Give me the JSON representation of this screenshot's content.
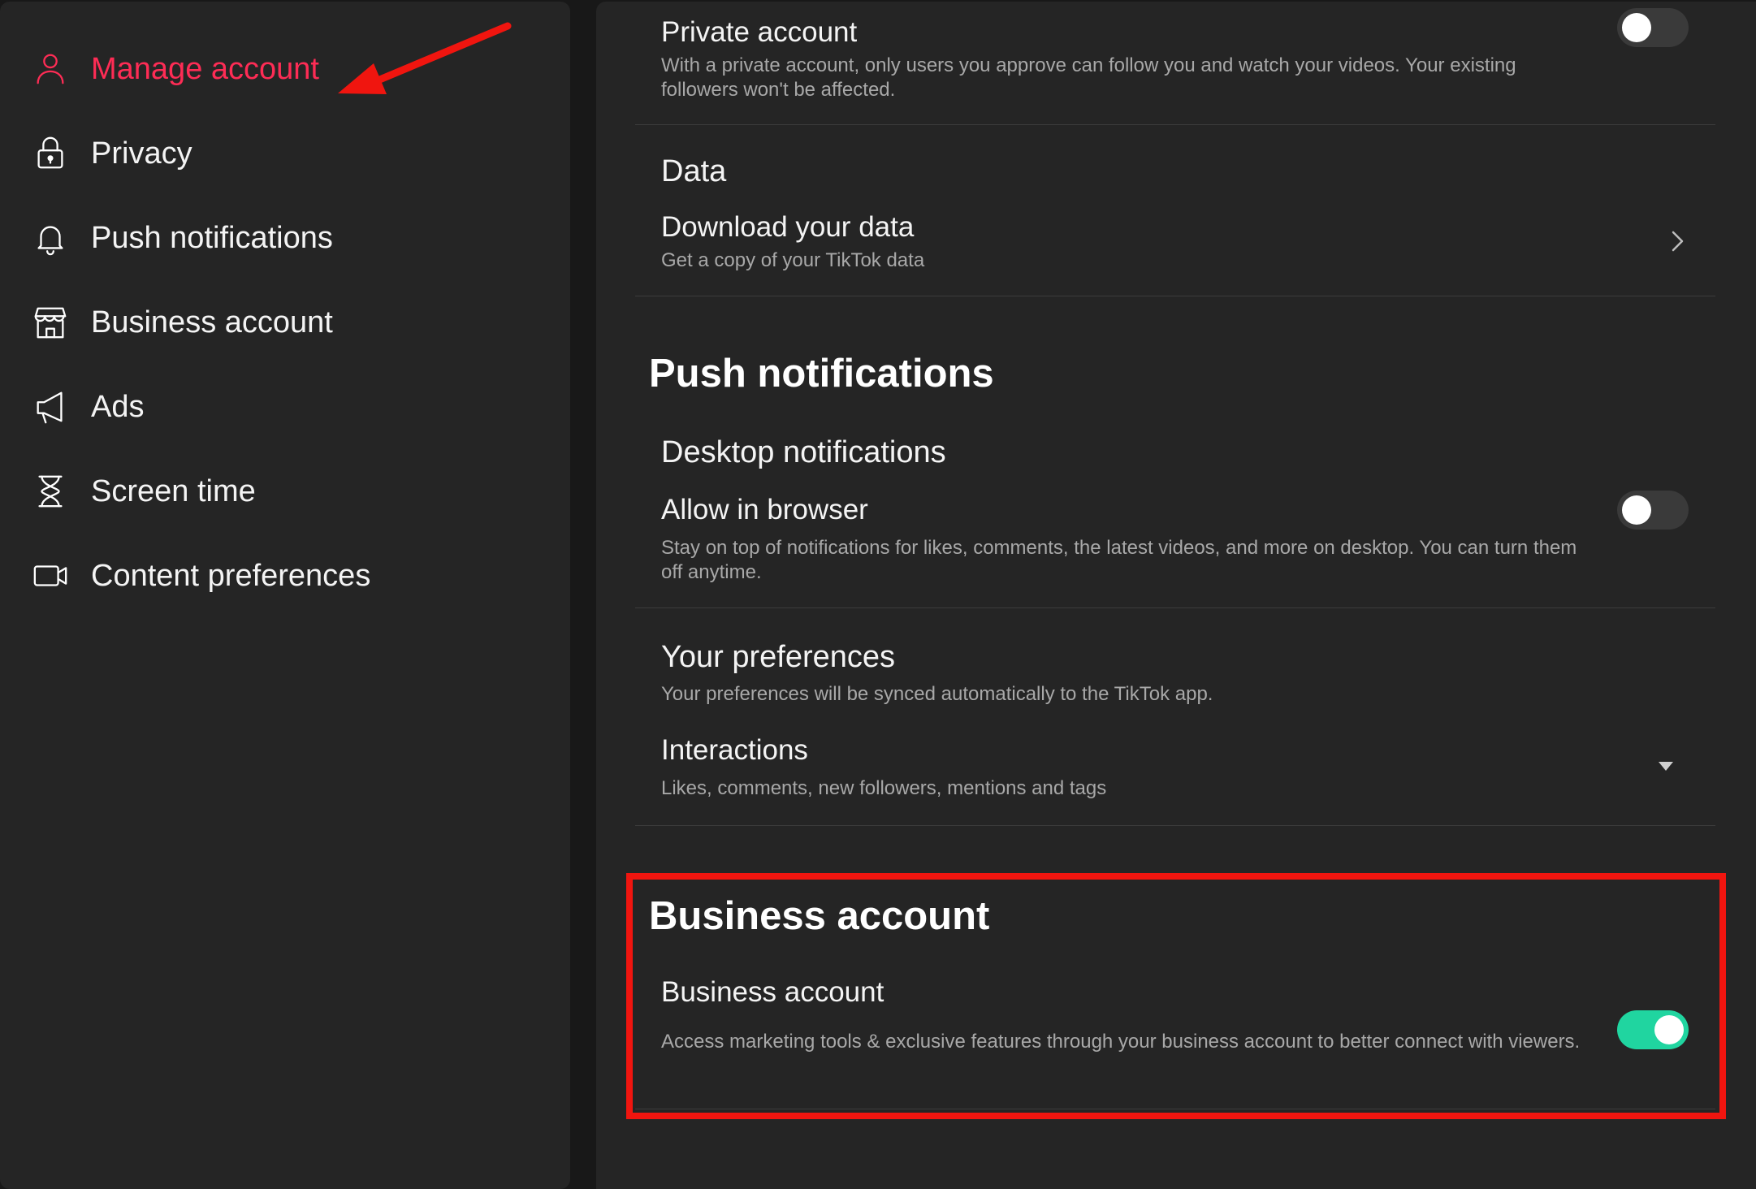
{
  "sidebar": {
    "items": [
      {
        "label": "Manage account",
        "icon": "person-icon",
        "active": true
      },
      {
        "label": "Privacy",
        "icon": "lock-icon"
      },
      {
        "label": "Push notifications",
        "icon": "bell-icon"
      },
      {
        "label": "Business account",
        "icon": "storefront-icon"
      },
      {
        "label": "Ads",
        "icon": "megaphone-icon"
      },
      {
        "label": "Screen time",
        "icon": "hourglass-icon"
      },
      {
        "label": "Content preferences",
        "icon": "video-camera-icon"
      }
    ]
  },
  "privacy": {
    "private_account": {
      "title": "Private account",
      "desc": "With a private account, only users you approve can follow you and watch your videos. Your existing followers won't be affected.",
      "enabled": false
    }
  },
  "data": {
    "group_title": "Data",
    "download": {
      "title": "Download your data",
      "desc": "Get a copy of your TikTok data"
    }
  },
  "push": {
    "section_title": "Push notifications",
    "desktop_group": "Desktop notifications",
    "allow_browser": {
      "title": "Allow in browser",
      "desc": "Stay on top of notifications for likes, comments, the latest videos, and more on desktop. You can turn them off anytime.",
      "enabled": false
    },
    "preferences": {
      "group_title": "Your preferences",
      "desc": "Your preferences will be synced automatically to the TikTok app."
    },
    "interactions": {
      "title": "Interactions",
      "desc": "Likes, comments, new followers, mentions and tags"
    }
  },
  "business": {
    "section_title": "Business account",
    "row_title": "Business account",
    "desc": "Access marketing tools & exclusive features through your business account to better connect with viewers.",
    "enabled": true
  },
  "colors": {
    "accent": "#fe2c55",
    "toggle_on": "#20d5a0",
    "annotation": "#f0150f"
  }
}
